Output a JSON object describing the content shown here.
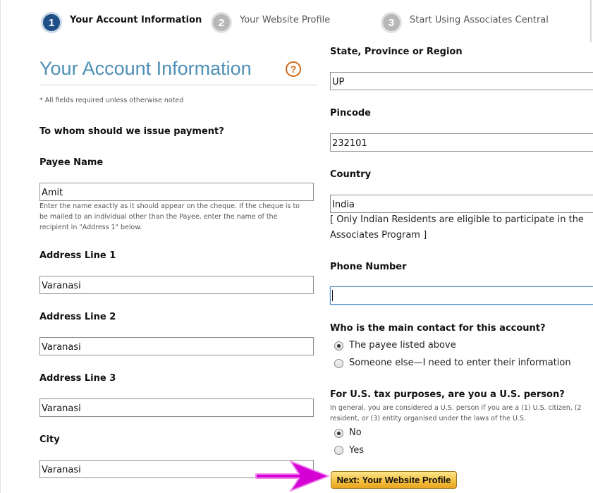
{
  "steps": [
    {
      "number": "1",
      "label": "Your Account Information"
    },
    {
      "number": "2",
      "label": "Your Website Profile"
    },
    {
      "number": "3",
      "label": "Start Using Associates Central"
    }
  ],
  "form": {
    "title": "Your Account Information",
    "help_icon": "question-circle-icon",
    "required_note": "* All fields required unless otherwise noted",
    "payment_question": "To whom should we issue payment?",
    "payee_name": {
      "label": "Payee Name",
      "value": "Amit",
      "help_lines": [
        "Enter the name exactly as it should appear on the cheque. If the cheque is to",
        "be mailed to an individual other than the Payee, enter the name of the",
        "recipient in \"Address 1\" below."
      ]
    },
    "address1": {
      "label": "Address Line 1",
      "value": "Varanasi"
    },
    "address2": {
      "label": "Address Line 2",
      "value": "Varanasi"
    },
    "address3": {
      "label": "Address Line 3",
      "value": "Varanasi"
    },
    "city": {
      "label": "City",
      "value": "Varanasi"
    },
    "state": {
      "label": "State, Province or Region",
      "value": "UP"
    },
    "pincode": {
      "label": "Pincode",
      "value": "232101"
    },
    "country": {
      "label": "Country",
      "value": "India",
      "note_lines": [
        "[ Only Indian Residents are eligible to participate in the",
        "Associates Program ]"
      ]
    },
    "phone": {
      "label": "Phone Number",
      "value": ""
    },
    "main_contact": {
      "question": "Who is the main contact for this account?",
      "options": [
        {
          "label": "The payee listed above",
          "checked": true
        },
        {
          "label": "Someone else—I need to enter their information",
          "checked": false
        }
      ]
    },
    "us_person": {
      "question": "For U.S. tax purposes, are you a U.S. person?",
      "help_lines": [
        "In general, you are considered a U.S. person if you are a (1) U.S. citizen, (2",
        "resident, or (3) entity organised under the laws of the U.S."
      ],
      "options": [
        {
          "label": "No",
          "checked": true
        },
        {
          "label": "Yes",
          "checked": false
        }
      ]
    },
    "next_button": "Next:  Your Website Profile"
  },
  "colors": {
    "title": "#4e8fb6",
    "step_active": "#1e4f86",
    "step_inactive": "#b7b7b7",
    "help_icon": "#d26a1a",
    "arrow": "#d400d4",
    "button": "#f3bd3c"
  }
}
